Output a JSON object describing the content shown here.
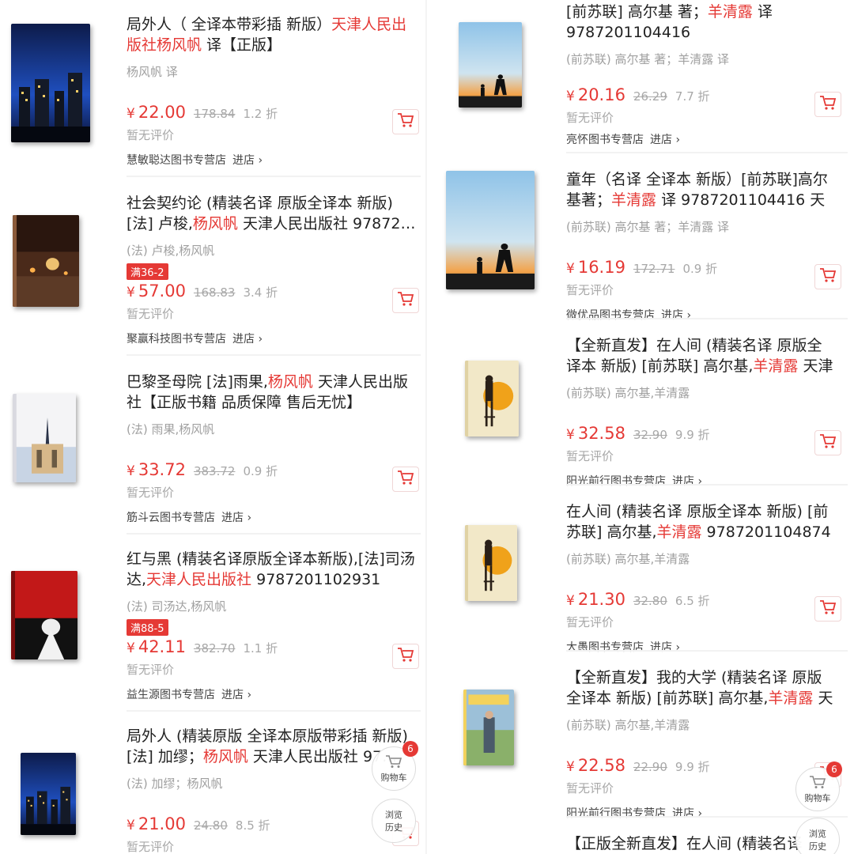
{
  "left_column": [
    {
      "title_parts": [
        {
          "t": "局外人（ 全译本带彩插 新版）",
          "hl": false
        },
        {
          "t": "天津人民出版社杨风帆",
          "hl": true
        },
        {
          "t": " 译【正版】",
          "hl": false
        }
      ],
      "author": "杨风帆 译",
      "promo": "",
      "price": "22.00",
      "original_price": "178.84",
      "discount": "1.2 折",
      "rating": "暂无评价",
      "store": "慧敏聪达图书专营店",
      "enter": "进店 ›",
      "cover": "night-city"
    },
    {
      "title_parts": [
        {
          "t": "社会契约论 (精装名译 原版全译本 新版) [法] 卢梭,",
          "hl": false
        },
        {
          "t": "杨风帆",
          "hl": true
        },
        {
          "t": " 天津人民出版社 97872…",
          "hl": false
        }
      ],
      "author": "(法) 卢梭,杨风帆",
      "promo": "满36-2",
      "price": "57.00",
      "original_price": "168.83",
      "discount": "3.4 折",
      "rating": "暂无评价",
      "store": "聚赢科技图书专营店",
      "enter": "进店 ›",
      "cover": "brown-lights"
    },
    {
      "title_parts": [
        {
          "t": "巴黎圣母院 [法]雨果,",
          "hl": false
        },
        {
          "t": "杨风帆",
          "hl": true
        },
        {
          "t": " 天津人民出版社【正版书籍 品质保障 售后无忧】",
          "hl": false
        }
      ],
      "author": "(法) 雨果,杨风帆",
      "promo": "",
      "price": "33.72",
      "original_price": "383.72",
      "discount": "0.9 折",
      "rating": "暂无评价",
      "store": "筋斗云图书专营店",
      "enter": "进店 ›",
      "cover": "cathedral"
    },
    {
      "title_parts": [
        {
          "t": "红与黑 (精装名译原版全译本新版),[法]司汤达,",
          "hl": false
        },
        {
          "t": "天津人民出版社",
          "hl": true
        },
        {
          "t": " 9787201102931",
          "hl": false
        }
      ],
      "author": "(法) 司汤达,杨风帆",
      "promo": "满88-5",
      "price": "42.11",
      "original_price": "382.70",
      "discount": "1.1 折",
      "rating": "暂无评价",
      "store": "益生源图书专营店",
      "enter": "进店 ›",
      "cover": "red-black"
    },
    {
      "title_parts": [
        {
          "t": "局外人 (精装原版 全译本原版带彩插 新版) [法] 加缪；",
          "hl": false
        },
        {
          "t": "杨风帆",
          "hl": true
        },
        {
          "t": " 天津人民出版社 97…",
          "hl": false
        }
      ],
      "author": "(法) 加缪；杨风帆",
      "promo": "",
      "price": "21.00",
      "original_price": "24.80",
      "discount": "8.5 折",
      "rating": "暂无评价",
      "store": "",
      "enter": "",
      "cover": "night-city"
    }
  ],
  "right_column": [
    {
      "title_parts": [
        {
          "t": "[前苏联] 高尔基 著；",
          "hl": false
        },
        {
          "t": "羊清露",
          "hl": true
        },
        {
          "t": " 译 9787201104416",
          "hl": false
        }
      ],
      "author": "(前苏联) 高尔基 著；羊清露 译",
      "promo": "",
      "price": "20.16",
      "original_price": "26.29",
      "discount": "7.7 折",
      "rating": "暂无评价",
      "store": "亮怀图书专营店",
      "enter": "进店 ›",
      "cover": "sunset-kids"
    },
    {
      "title_parts": [
        {
          "t": "童年（名译 全译本 新版）[前苏联]高尔基著；",
          "hl": false
        },
        {
          "t": "羊清露",
          "hl": true
        },
        {
          "t": " 译 9787201104416 天津人…",
          "hl": false
        }
      ],
      "author": "(前苏联) 高尔基 著；羊清露 译",
      "promo": "",
      "price": "16.19",
      "original_price": "172.71",
      "discount": "0.9 折",
      "rating": "暂无评价",
      "store": "微优品图书专营店",
      "enter": "进店 ›",
      "cover": "sunset-kids"
    },
    {
      "title_parts": [
        {
          "t": "【全新直发】在人间 (精装名译 原版全译本 新版) [前苏联] 高尔基,",
          "hl": false
        },
        {
          "t": "羊清露",
          "hl": true
        },
        {
          "t": " 天津人…",
          "hl": false
        }
      ],
      "author": "(前苏联) 高尔基,羊清露",
      "promo": "",
      "price": "32.58",
      "original_price": "32.90",
      "discount": "9.9 折",
      "rating": "暂无评价",
      "store": "阳光前行图书专营店",
      "enter": "进店 ›",
      "cover": "yellow-sun"
    },
    {
      "title_parts": [
        {
          "t": "在人间 (精装名译 原版全译本 新版) [前苏联] 高尔基,",
          "hl": false
        },
        {
          "t": "羊清露",
          "hl": true
        },
        {
          "t": " 9787201104874 天…",
          "hl": false
        }
      ],
      "author": "(前苏联) 高尔基,羊清露",
      "promo": "",
      "price": "21.30",
      "original_price": "32.80",
      "discount": "6.5 折",
      "rating": "暂无评价",
      "store": "大愚图书专营店",
      "enter": "进店 ›",
      "cover": "yellow-sun"
    },
    {
      "title_parts": [
        {
          "t": "【全新直发】我的大学 (精装名译 原版全译本 新版) [前苏联] 高尔基,",
          "hl": false
        },
        {
          "t": "羊清露",
          "hl": true
        },
        {
          "t": " 天津…",
          "hl": false
        }
      ],
      "author": "(前苏联) 高尔基,羊清露",
      "promo": "",
      "price": "22.58",
      "original_price": "22.90",
      "discount": "9.9 折",
      "rating": "暂无评价",
      "store": "阳光前行图书专营店",
      "enter": "进店 ›",
      "cover": "university"
    },
    {
      "title_parts": [
        {
          "t": "【正版全新直发】在人间 (精装名译",
          "hl": false
        }
      ],
      "author": "",
      "promo": "",
      "price": "",
      "original_price": "",
      "discount": "",
      "rating": "",
      "store": "",
      "enter": "",
      "cover": ""
    }
  ],
  "floating": {
    "cart_label": "购物车",
    "cart_badge": "6",
    "history_label_1": "浏览",
    "history_label_2": "历史"
  },
  "currency_symbol": "¥",
  "colors": {
    "accent": "#e53935",
    "muted": "#a8a8a8"
  }
}
